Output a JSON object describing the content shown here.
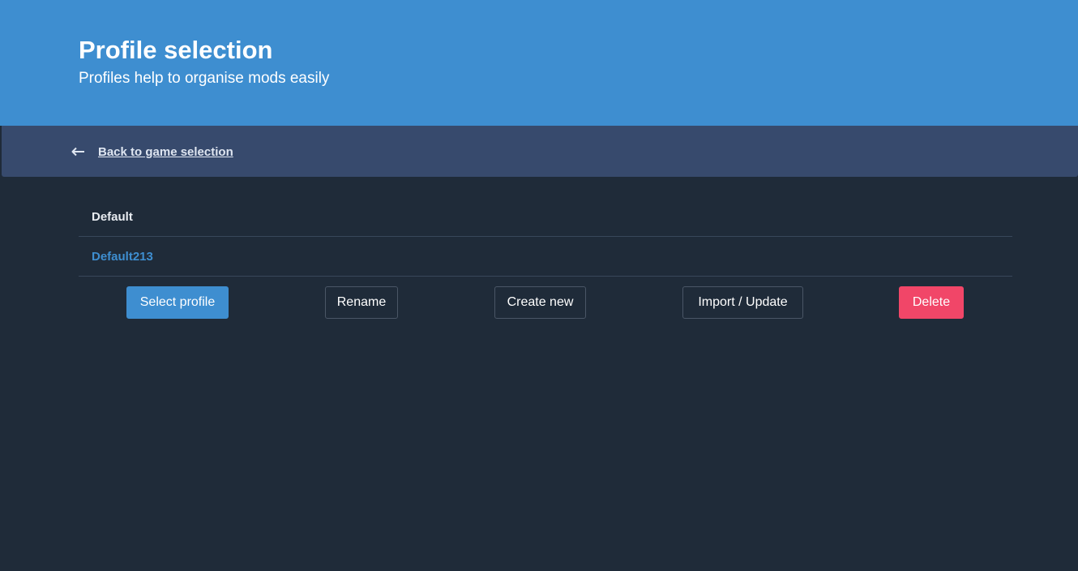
{
  "hero": {
    "title": "Profile selection",
    "subtitle": "Profiles help to organise mods easily"
  },
  "nav": {
    "back_icon": "arrow-left-icon",
    "back_label": "Back to game selection"
  },
  "profiles": [
    {
      "name": "Default",
      "selected": false
    },
    {
      "name": "Default213",
      "selected": true
    }
  ],
  "actions": {
    "select_label": "Select profile",
    "rename_label": "Rename",
    "create_label": "Create new",
    "import_label": "Import / Update",
    "delete_label": "Delete"
  },
  "colors": {
    "hero_bg": "#3e8ed0",
    "nav_bg": "#374a6d",
    "page_bg": "#1f2b39",
    "primary": "#3e8ed0",
    "danger": "#f14668"
  }
}
